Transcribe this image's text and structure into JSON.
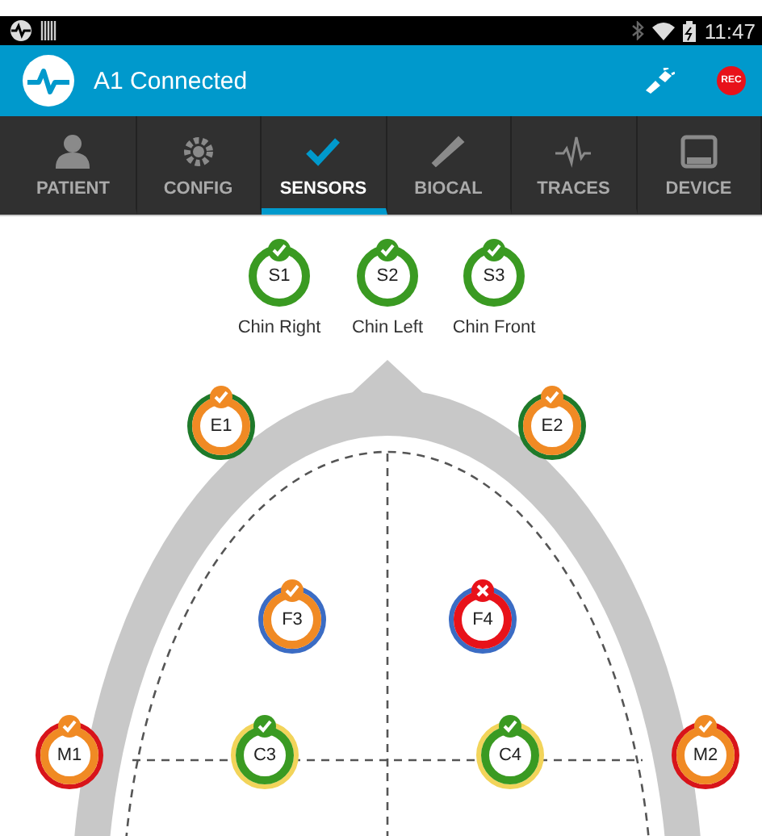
{
  "status_bar": {
    "time": "11:47"
  },
  "app_bar": {
    "title": "A1 Connected",
    "record_label": "REC"
  },
  "tabs": [
    {
      "label": "PATIENT",
      "selected": false
    },
    {
      "label": "CONFIG",
      "selected": false
    },
    {
      "label": "SENSORS",
      "selected": true
    },
    {
      "label": "BIOCAL",
      "selected": false
    },
    {
      "label": "TRACES",
      "selected": false
    },
    {
      "label": "DEVICE",
      "selected": false
    }
  ],
  "chin_sensors": [
    {
      "label": "S1",
      "caption": "Chin Right",
      "color": "#3a9a22",
      "checked": true
    },
    {
      "label": "S2",
      "caption": "Chin Left",
      "color": "#3a9a22",
      "checked": true
    },
    {
      "label": "S3",
      "caption": "Chin Front",
      "color": "#3a9a22",
      "checked": true
    }
  ],
  "head_sensors": [
    {
      "label": "E1",
      "color": "#f08a24",
      "band": {
        "color": "#1f7a2a"
      },
      "checked": true
    },
    {
      "label": "E2",
      "color": "#f08a24",
      "band": {
        "color": "#1f7a2a"
      },
      "checked": true
    },
    {
      "label": "F3",
      "color": "#f08a24",
      "band": {
        "color": "#3b6cc4"
      },
      "checked": true
    },
    {
      "label": "F4",
      "color": "#e8121a",
      "band": {
        "color": "#3b6cc4"
      },
      "checked": false
    },
    {
      "label": "M1",
      "color": "#f08a24",
      "band": {
        "color": "#d8141a"
      },
      "checked": true
    },
    {
      "label": "C3",
      "color": "#3a9a22",
      "band": {
        "color": "#f2d45a"
      },
      "checked": true
    },
    {
      "label": "C4",
      "color": "#3a9a22",
      "band": {
        "color": "#f2d45a"
      },
      "checked": true
    },
    {
      "label": "M2",
      "color": "#f08a24",
      "band": {
        "color": "#d8141a"
      },
      "checked": true
    }
  ]
}
